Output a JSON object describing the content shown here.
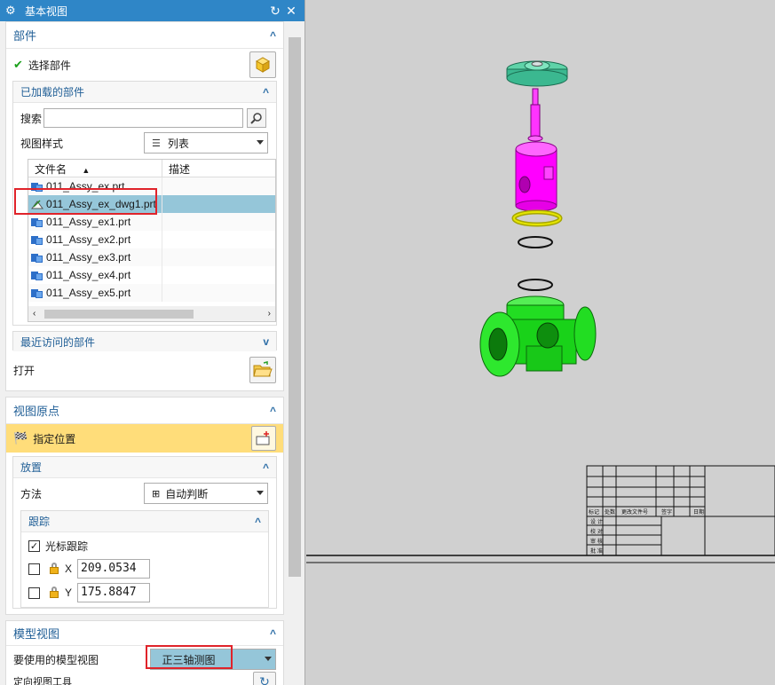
{
  "dialog": {
    "title": "基本视图",
    "icon": "gear-icon",
    "reset_icon": "reset-icon",
    "close_icon": "close-icon"
  },
  "parts": {
    "header": "部件",
    "select_part_label": "选择部件",
    "loaded_parts": {
      "header": "已加载的部件",
      "search_label": "搜索",
      "search_value": "",
      "view_style_label": "视图样式",
      "view_style_value": "列表",
      "columns": [
        "文件名",
        "描述"
      ],
      "files": [
        {
          "name": "011_Assy_ex.prt",
          "selected": false
        },
        {
          "name": "011_Assy_ex_dwg1.prt",
          "selected": true
        },
        {
          "name": "011_Assy_ex1.prt",
          "selected": false
        },
        {
          "name": "011_Assy_ex2.prt",
          "selected": false
        },
        {
          "name": "011_Assy_ex3.prt",
          "selected": false
        },
        {
          "name": "011_Assy_ex4.prt",
          "selected": false
        },
        {
          "name": "011_Assy_ex5.prt",
          "selected": false
        }
      ]
    },
    "recent_parts": {
      "header": "最近访问的部件"
    },
    "open_label": "打开"
  },
  "view_origin": {
    "header": "视图原点",
    "specify_location_label": "指定位置",
    "placement": {
      "header": "放置",
      "method_label": "方法",
      "method_value": "自动判断"
    },
    "tracking": {
      "header": "跟踪",
      "cursor_tracking_label": "光标跟踪",
      "cursor_tracking_checked": true,
      "x_label": "X",
      "x_value": "209.0534",
      "y_label": "Y",
      "y_value": "175.8847"
    }
  },
  "model_view": {
    "header": "模型视图",
    "model_view_to_use_label": "要使用的模型视图",
    "model_view_value": "正三轴测图",
    "orient_tool_label": "定向视图工具"
  },
  "title_block": {
    "row_labels": [
      "标记",
      "处数",
      "更改文件号",
      "签字",
      "日期"
    ],
    "side_labels": [
      "设 计",
      "校 对",
      "审 核",
      "批 准"
    ]
  },
  "colors": {
    "accent": "#2f86c7",
    "selected_row": "#95c6d9",
    "highlight_row": "#ffdd7a",
    "red_callout": "#e0232a",
    "canvas_bg": "#d0d0d0",
    "part_magenta": "#ff00ff",
    "part_green": "#1fe01f",
    "part_teal": "#3bb890",
    "part_yellow": "#e6e600"
  }
}
